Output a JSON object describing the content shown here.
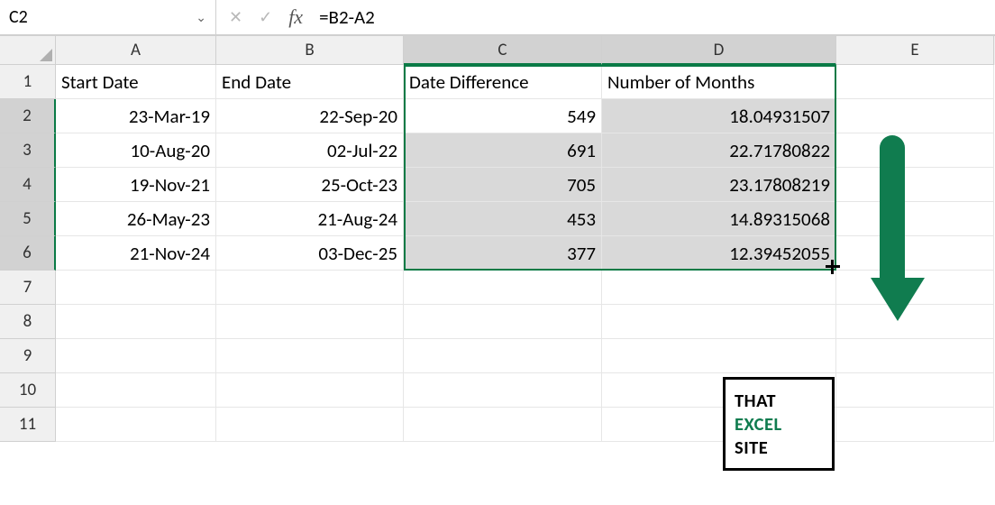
{
  "formula_bar": {
    "name_box": "C2",
    "formula": "=B2-A2"
  },
  "columns": [
    "A",
    "B",
    "C",
    "D",
    "E"
  ],
  "row_numbers": [
    "1",
    "2",
    "3",
    "4",
    "5",
    "6",
    "7",
    "8",
    "9",
    "10",
    "11"
  ],
  "headers": {
    "A": "Start Date",
    "B": "End Date",
    "C": "Date Difference",
    "D": "Number of Months"
  },
  "table": [
    {
      "A": "23-Mar-19",
      "B": "22-Sep-20",
      "C": "549",
      "D": "18.04931507"
    },
    {
      "A": "10-Aug-20",
      "B": "02-Jul-22",
      "C": "691",
      "D": "22.71780822"
    },
    {
      "A": "19-Nov-21",
      "B": "25-Oct-23",
      "C": "705",
      "D": "23.17808219"
    },
    {
      "A": "26-May-23",
      "B": "21-Aug-24",
      "C": "453",
      "D": "14.89315068"
    },
    {
      "A": "21-Nov-24",
      "B": "03-Dec-25",
      "C": "377",
      "D": "12.39452055"
    }
  ],
  "logo": {
    "l1": "THAT",
    "l2": "EXCEL",
    "l3": "SITE"
  },
  "chart_data": {
    "type": "table",
    "columns": [
      "Start Date",
      "End Date",
      "Date Difference",
      "Number of Months"
    ],
    "rows": [
      [
        "23-Mar-19",
        "22-Sep-20",
        549,
        18.04931507
      ],
      [
        "10-Aug-20",
        "02-Jul-22",
        691,
        22.71780822
      ],
      [
        "19-Nov-21",
        "25-Oct-23",
        705,
        23.17808219
      ],
      [
        "26-May-23",
        "21-Aug-24",
        453,
        14.89315068
      ],
      [
        "21-Nov-24",
        "03-Dec-25",
        377,
        12.39452055
      ]
    ]
  },
  "selection": {
    "range": "C2:D6",
    "active": "C2"
  }
}
